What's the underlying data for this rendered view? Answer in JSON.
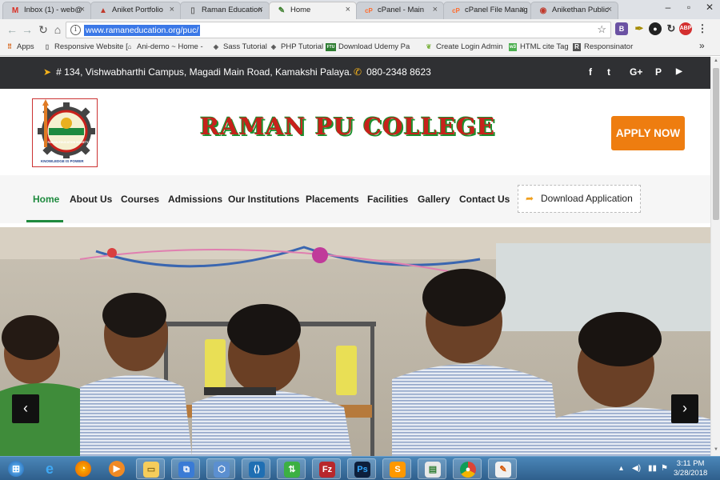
{
  "browser": {
    "tabs": [
      {
        "title": "Inbox (1) - web@",
        "icon": "gmail-icon",
        "icon_glyph": "M",
        "icon_color": "#d93025"
      },
      {
        "title": "Aniket Portfolio",
        "icon": "portfolio-icon",
        "icon_glyph": "▲",
        "icon_color": "#c0392b"
      },
      {
        "title": "Raman Education",
        "icon": "page-icon",
        "icon_glyph": "▯",
        "icon_color": "#666666"
      },
      {
        "title": "Home",
        "icon": "leaf-icon",
        "icon_glyph": "✎",
        "icon_color": "#3a7d2a"
      },
      {
        "title": "cPanel - Main",
        "icon": "cpanel-icon",
        "icon_glyph": "cP",
        "icon_color": "#ff6c2c"
      },
      {
        "title": "cPanel File Manag",
        "icon": "cpanel-icon",
        "icon_glyph": "cP",
        "icon_color": "#ff6c2c"
      },
      {
        "title": "Anikethan Public",
        "icon": "school-icon",
        "icon_glyph": "◉",
        "icon_color": "#c0392b"
      }
    ],
    "url": "www.ramaneducation.org/puc/",
    "bookmarks": [
      {
        "label": "Apps",
        "icon": "apps-grid-icon",
        "glyph": "⠿",
        "color": "#d35400"
      },
      {
        "label": "Responsive Website [",
        "icon": "page-icon",
        "glyph": "▯",
        "color": "#666"
      },
      {
        "label": "Ani-demo ~ Home -",
        "icon": "home-icon",
        "glyph": "⌂",
        "color": "#333"
      },
      {
        "label": "Sass Tutorial",
        "icon": "diamond-icon",
        "glyph": "◈",
        "color": "#555"
      },
      {
        "label": "PHP Tutorial",
        "icon": "diamond-icon",
        "glyph": "◈",
        "color": "#555"
      },
      {
        "label": "Download Udemy Pa",
        "icon": "udemy-icon",
        "glyph": "FTU",
        "color": "#2e7d32"
      },
      {
        "label": "Create Login Admin",
        "icon": "plant-icon",
        "glyph": "❦",
        "color": "#7cb342"
      },
      {
        "label": "HTML cite Tag",
        "icon": "w3-icon",
        "glyph": "w3",
        "color": "#4caf50"
      },
      {
        "label": "Responsinator",
        "icon": "r-icon",
        "glyph": "R",
        "color": "#555"
      }
    ],
    "more_bookmarks": "»"
  },
  "site": {
    "address": "# 134, Vishwabharthi Campus, Magadi Main Road, Kamakshi Palaya.",
    "phone": "080-2348 8623",
    "social": [
      "f",
      "t",
      "G+",
      "P",
      "▶"
    ],
    "college_name": "RAMAN PU COLLEGE",
    "apply_label": "APPLY NOW",
    "logo_text": "RAMAN EDUCATION SOCIETY",
    "logo_motto": "KNOWLEDGE IS POWER",
    "nav": [
      "Home",
      "About Us",
      "Courses",
      "Admissions",
      "Our Institutions",
      "Placements",
      "Facilities",
      "Gallery",
      "Contact Us"
    ],
    "download_label": "Download Application",
    "prev_label": "‹",
    "next_label": "›"
  },
  "taskbar": {
    "time": "3:11 PM",
    "date": "3/28/2018",
    "accent": "#2f5f8c"
  }
}
